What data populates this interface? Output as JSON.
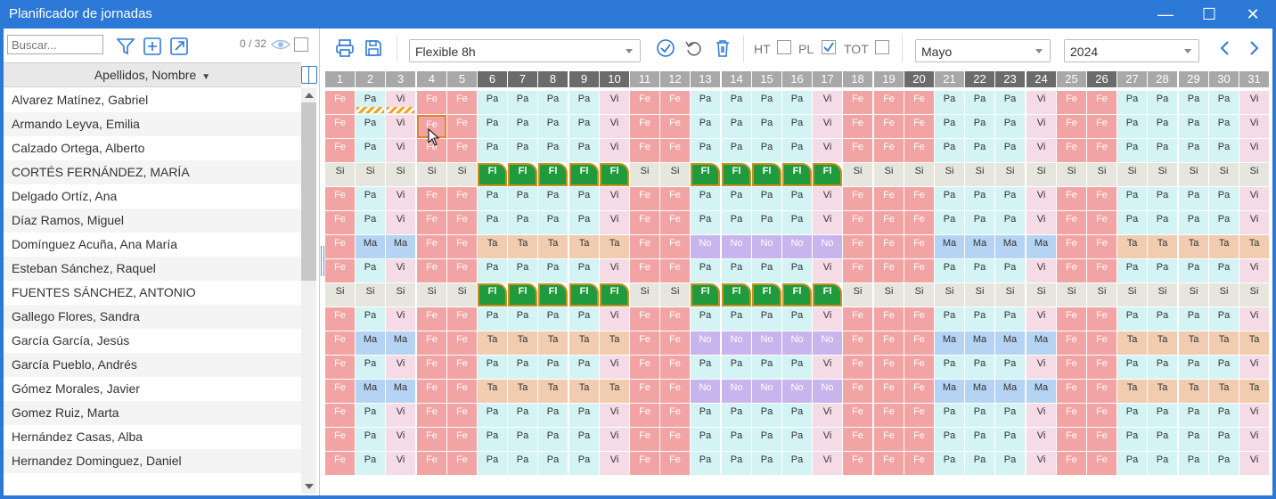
{
  "window": {
    "title": "Planificador de jornadas"
  },
  "left": {
    "search_placeholder": "Buscar...",
    "count": "0 / 32",
    "column_header": "Apellidos, Nombre",
    "names": [
      "Alvarez Matínez, Gabriel",
      "Armando Leyva, Emilia",
      "Calzado Ortega, Alberto",
      "CORTÉS FERNÁNDEZ, MARÍA",
      "Delgado Ortíz, Ana",
      "Díaz Ramos, Miguel",
      "Domínguez Acuña, Ana María",
      "Esteban Sánchez, Raquel",
      "FUENTES SÁNCHEZ, ANTONIO",
      "Gallego Flores, Sandra",
      "García García, Jesús",
      "García Pueblo, Andrés",
      "Gómez Morales, Javier",
      "Gomez Ruiz, Marta",
      "Hernández Casas, Alba",
      "Hernandez Dominguez, Daniel"
    ]
  },
  "toolbar": {
    "schedule": "Flexible 8h",
    "ht_label": "HT",
    "pl_label": "PL",
    "tot_label": "TOT",
    "month": "Mayo",
    "year": "2024"
  },
  "colors": {
    "accent": "#2b78d6",
    "Fe": "#f2a3a3",
    "Pa": "#d3f3f5",
    "Vi": "#f4dbe6",
    "Si": "#e7e6de",
    "Fl": "#1f9a3d",
    "Ma": "#b5d3f2",
    "Ta": "#f1ccb1",
    "No": "#c8b5ee"
  },
  "calendar": {
    "days": [
      "1",
      "2",
      "3",
      "4",
      "5",
      "6",
      "7",
      "8",
      "9",
      "10",
      "11",
      "12",
      "13",
      "14",
      "15",
      "16",
      "17",
      "18",
      "19",
      "20",
      "21",
      "22",
      "23",
      "24",
      "25",
      "26",
      "27",
      "28",
      "29",
      "30",
      "31"
    ],
    "dark_days": [
      "6",
      "7",
      "8",
      "9",
      "10",
      "20",
      "22",
      "23",
      "24",
      "26"
    ],
    "patterns": {
      "A": [
        "Fe",
        "Pa",
        "Vi",
        "Fe",
        "Fe",
        "Pa",
        "Pa",
        "Pa",
        "Pa",
        "Vi",
        "Fe",
        "Fe",
        "Pa",
        "Pa",
        "Pa",
        "Pa",
        "Vi",
        "Fe",
        "Fe",
        "Fe",
        "Pa",
        "Pa",
        "Pa",
        "Vi",
        "Fe",
        "Fe",
        "Pa",
        "Pa",
        "Pa",
        "Pa",
        "Vi"
      ],
      "B": [
        "Si",
        "Si",
        "Si",
        "Si",
        "Si",
        "Fl",
        "Fl",
        "Fl",
        "Fl",
        "Fl",
        "Si",
        "Si",
        "Fl",
        "Fl",
        "Fl",
        "Fl",
        "Fl",
        "Si",
        "Si",
        "Si",
        "Si",
        "Si",
        "Si",
        "Si",
        "Si",
        "Si",
        "Si",
        "Si",
        "Si",
        "Si",
        "Si"
      ],
      "C": [
        "Fe",
        "Ma",
        "Ma",
        "Fe",
        "Fe",
        "Ta",
        "Ta",
        "Ta",
        "Ta",
        "Ta",
        "Fe",
        "Fe",
        "No",
        "No",
        "No",
        "No",
        "No",
        "Fe",
        "Fe",
        "Fe",
        "Ma",
        "Ma",
        "Ma",
        "Ma",
        "Fe",
        "Fe",
        "Ta",
        "Ta",
        "Ta",
        "Ta",
        "Ta"
      ]
    },
    "rows": [
      "A",
      "A",
      "A",
      "B",
      "A",
      "A",
      "C",
      "A",
      "B",
      "A",
      "C",
      "A",
      "C",
      "A",
      "A",
      "A"
    ],
    "striped_cells": [
      [
        0,
        1
      ],
      [
        0,
        2
      ]
    ],
    "selected_cell": [
      1,
      3
    ]
  }
}
